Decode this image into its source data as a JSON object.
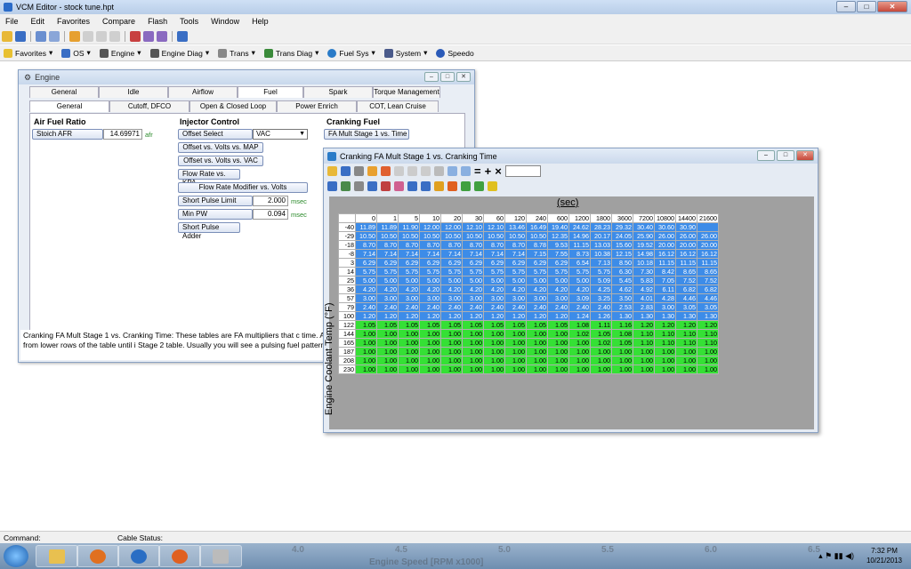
{
  "app": {
    "title": "VCM Editor - stock tune.hpt"
  },
  "menu": [
    "File",
    "Edit",
    "Favorites",
    "Compare",
    "Flash",
    "Tools",
    "Window",
    "Help"
  ],
  "toolbar2": [
    "Favorites",
    "OS",
    "Engine",
    "Engine Diag",
    "Trans",
    "Trans Diag",
    "Fuel Sys",
    "System",
    "Speedo"
  ],
  "engine": {
    "title": "Engine",
    "tabs_top": [
      "General",
      "Idle",
      "Airflow",
      "Fuel",
      "Spark",
      "Torque Management"
    ],
    "tabs_bottom": [
      "General",
      "Cutoff, DFCO",
      "Open & Closed Loop",
      "Power Enrich",
      "COT, Lean Cruise"
    ],
    "air_fuel": {
      "heading": "Air Fuel Ratio",
      "label": "Stoich AFR",
      "value": "14.69971",
      "unit": "afr"
    },
    "injector": {
      "heading": "Injector Control",
      "offset_select_label": "Offset Select",
      "offset_select_value": "VAC",
      "btn_map": "Offset vs. Volts vs. MAP",
      "btn_vac": "Offset vs. Volts vs. VAC",
      "btn_flow": "Flow Rate vs. KPA",
      "btn_flowmod": "Flow Rate Modifier vs. Volts",
      "short_pulse_label": "Short Pulse Limit",
      "short_pulse_value": "2.000",
      "short_pulse_unit": "msec",
      "min_pw_label": "Min PW",
      "min_pw_value": "0.094",
      "min_pw_unit": "msec",
      "short_adder": "Short Pulse Adder"
    },
    "cranking": {
      "heading": "Cranking Fuel",
      "btn": "FA Mult Stage 1 vs. Time"
    },
    "description": "Cranking FA Mult Stage 1 vs. Cranking Time: These tables are FA multipliers that c time. As cranking continues the AFR is selected from lower rows of the table until i Stage 2 table. Usually you will see a pulsing fuel pattern in these tables."
  },
  "table_window": {
    "title": "Cranking FA Mult Stage 1 vs. Cranking Time",
    "x_label": "(sec)",
    "y_label": "Engine Coolant Temp (°F)",
    "cols": [
      "0",
      "1",
      "5",
      "10",
      "20",
      "30",
      "60",
      "120",
      "240",
      "600",
      "1200",
      "1800",
      "3600",
      "7200",
      "10800",
      "14400",
      "21600"
    ],
    "rows": [
      {
        "h": "-40",
        "v": [
          "11.89",
          "11.89",
          "11.90",
          "12.00",
          "12.00",
          "12.10",
          "12.10",
          "13.46",
          "16.49",
          "19.40",
          "24.62",
          "28.23",
          "29.32",
          "30.40",
          "30.60",
          "30.90"
        ]
      },
      {
        "h": "-29",
        "v": [
          "10.50",
          "10.50",
          "10.50",
          "10.50",
          "10.50",
          "10.50",
          "10.50",
          "10.50",
          "10.50",
          "12.35",
          "14.96",
          "20.17",
          "24.05",
          "25.90",
          "26.00",
          "26.00",
          "26.00"
        ]
      },
      {
        "h": "-18",
        "v": [
          "8.70",
          "8.70",
          "8.70",
          "8.70",
          "8.70",
          "8.70",
          "8.70",
          "8.70",
          "8.78",
          "9.53",
          "11.15",
          "13.03",
          "15.60",
          "19.52",
          "20.00",
          "20.00",
          "20.00"
        ]
      },
      {
        "h": "-8",
        "v": [
          "7.14",
          "7.14",
          "7.14",
          "7.14",
          "7.14",
          "7.14",
          "7.14",
          "7.14",
          "7.15",
          "7.55",
          "8.73",
          "10.38",
          "12.15",
          "14.98",
          "16.12",
          "16.12",
          "16.12"
        ]
      },
      {
        "h": "3",
        "v": [
          "6.29",
          "6.29",
          "6.29",
          "6.29",
          "6.29",
          "6.29",
          "6.29",
          "6.29",
          "6.29",
          "6.29",
          "6.54",
          "7.13",
          "8.50",
          "10.18",
          "11.15",
          "11.15",
          "11.15"
        ]
      },
      {
        "h": "14",
        "v": [
          "5.75",
          "5.75",
          "5.75",
          "5.75",
          "5.75",
          "5.75",
          "5.75",
          "5.75",
          "5.75",
          "5.75",
          "5.75",
          "5.75",
          "6.30",
          "7.30",
          "8.42",
          "8.65",
          "8.65"
        ]
      },
      {
        "h": "25",
        "v": [
          "5.00",
          "5.00",
          "5.00",
          "5.00",
          "5.00",
          "5.00",
          "5.00",
          "5.00",
          "5.00",
          "5.00",
          "5.00",
          "5.09",
          "5.45",
          "5.83",
          "7.05",
          "7.52",
          "7.52"
        ]
      },
      {
        "h": "36",
        "v": [
          "4.20",
          "4.20",
          "4.20",
          "4.20",
          "4.20",
          "4.20",
          "4.20",
          "4.20",
          "4.20",
          "4.20",
          "4.20",
          "4.25",
          "4.62",
          "4.92",
          "6.11",
          "6.82",
          "6.82"
        ]
      },
      {
        "h": "57",
        "v": [
          "3.00",
          "3.00",
          "3.00",
          "3.00",
          "3.00",
          "3.00",
          "3.00",
          "3.00",
          "3.00",
          "3.00",
          "3.09",
          "3.25",
          "3.50",
          "4.01",
          "4.28",
          "4.46",
          "4.46"
        ]
      },
      {
        "h": "79",
        "v": [
          "2.40",
          "2.40",
          "2.40",
          "2.40",
          "2.40",
          "2.40",
          "2.40",
          "2.40",
          "2.40",
          "2.40",
          "2.40",
          "2.40",
          "2.53",
          "2.83",
          "3.00",
          "3.05",
          "3.05"
        ]
      },
      {
        "h": "100",
        "v": [
          "1.20",
          "1.20",
          "1.20",
          "1.20",
          "1.20",
          "1.20",
          "1.20",
          "1.20",
          "1.20",
          "1.20",
          "1.24",
          "1.26",
          "1.30",
          "1.30",
          "1.30",
          "1.30",
          "1.30"
        ]
      },
      {
        "h": "122",
        "v": [
          "1.05",
          "1.05",
          "1.05",
          "1.05",
          "1.05",
          "1.05",
          "1.05",
          "1.05",
          "1.05",
          "1.05",
          "1.08",
          "1.11",
          "1.16",
          "1.20",
          "1.20",
          "1.20",
          "1.20"
        ]
      },
      {
        "h": "144",
        "v": [
          "1.00",
          "1.00",
          "1.00",
          "1.00",
          "1.00",
          "1.00",
          "1.00",
          "1.00",
          "1.00",
          "1.00",
          "1.02",
          "1.05",
          "1.08",
          "1.10",
          "1.10",
          "1.10",
          "1.10"
        ]
      },
      {
        "h": "165",
        "v": [
          "1.00",
          "1.00",
          "1.00",
          "1.00",
          "1.00",
          "1.00",
          "1.00",
          "1.00",
          "1.00",
          "1.00",
          "1.00",
          "1.02",
          "1.05",
          "1.10",
          "1.10",
          "1.10",
          "1.10"
        ]
      },
      {
        "h": "187",
        "v": [
          "1.00",
          "1.00",
          "1.00",
          "1.00",
          "1.00",
          "1.00",
          "1.00",
          "1.00",
          "1.00",
          "1.00",
          "1.00",
          "1.00",
          "1.00",
          "1.00",
          "1.00",
          "1.00",
          "1.00"
        ]
      },
      {
        "h": "208",
        "v": [
          "1.00",
          "1.00",
          "1.00",
          "1.00",
          "1.00",
          "1.00",
          "1.00",
          "1.00",
          "1.00",
          "1.00",
          "1.00",
          "1.00",
          "1.00",
          "1.00",
          "1.00",
          "1.00",
          "1.00"
        ]
      },
      {
        "h": "230",
        "v": [
          "1.00",
          "1.00",
          "1.00",
          "1.00",
          "1.00",
          "1.00",
          "1.00",
          "1.00",
          "1.00",
          "1.00",
          "1.00",
          "1.00",
          "1.00",
          "1.00",
          "1.00",
          "1.00",
          "1.00"
        ]
      }
    ],
    "green_from_row": 11
  },
  "status": {
    "command": "Command:",
    "cable": "Cable Status:"
  },
  "taskbar": {
    "bg_labels": [
      "4.0",
      "4.5",
      "5.0",
      "5.5",
      "6.0",
      "6.5"
    ],
    "bg_axis_title": "Engine Speed [RPM x1000]",
    "time": "7:32 PM",
    "date": "10/21/2013"
  },
  "colors": {
    "blue_cell": "#3d8ce8",
    "green_cell": "#35e035"
  }
}
